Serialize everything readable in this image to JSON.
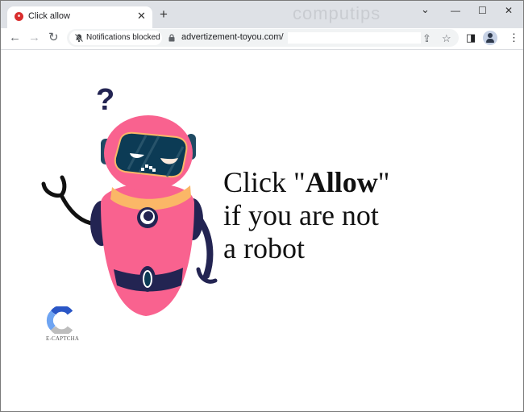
{
  "browser": {
    "tab": {
      "title": "Click allow",
      "close_glyph": "✕"
    },
    "new_tab_glyph": "+",
    "watermark": "computips",
    "window_controls": {
      "dropdown": "⌄",
      "minimize": "—",
      "maximize": "☐",
      "close": "✕"
    },
    "nav": {
      "back": "←",
      "forward": "→",
      "reload": "↻"
    },
    "notification_chip": "Notifications blocked",
    "url": "advertizement-toyou.com/",
    "toolbar_icons": {
      "share": "⇪",
      "bookmark": "☆",
      "side_panel": "◨",
      "menu": "⋮"
    }
  },
  "page": {
    "headline": {
      "line1_prefix": "Click \"",
      "line1_bold": "Allow",
      "line1_suffix": "\"",
      "line2": "if you are not",
      "line3": "a robot"
    },
    "question_mark": "?",
    "captcha_label": "E-CAPTCHA",
    "colors": {
      "robot_pink": "#f9628f",
      "robot_navy": "#232452",
      "visor": "#0c3b55",
      "collar": "#fbb767",
      "captcha_dark_blue": "#2a56c6",
      "captcha_light_blue": "#6ea4f2",
      "captcha_gray": "#bdbdbd"
    }
  }
}
